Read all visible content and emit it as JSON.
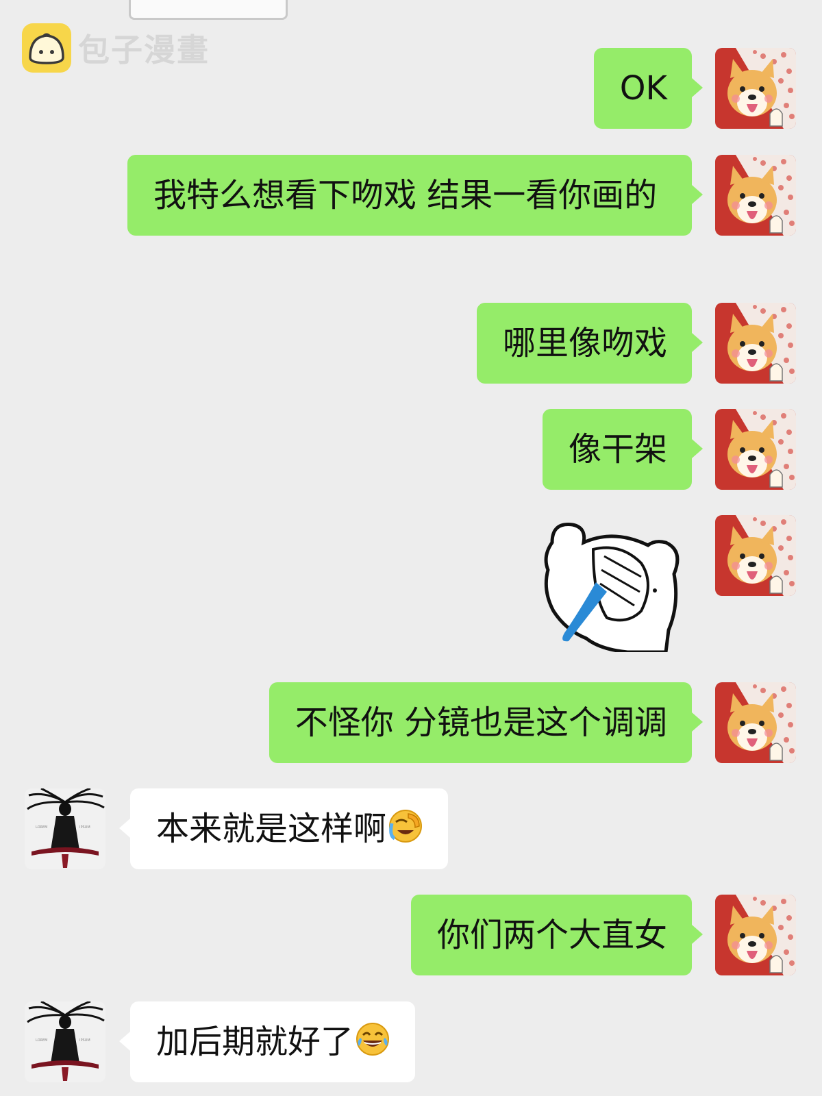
{
  "watermark": {
    "text": "包子漫畫"
  },
  "messages": [
    {
      "side": "right",
      "text": "OK"
    },
    {
      "side": "right",
      "text": "我特么想看下吻戏  结果一看你画的"
    },
    {
      "side": "right",
      "text": "哪里像吻戏"
    },
    {
      "side": "right",
      "text": "像干架"
    },
    {
      "side": "right",
      "type": "sticker",
      "sticker": "crying-bear-facepalm"
    },
    {
      "side": "right",
      "text": "不怪你  分镜也是这个调调"
    },
    {
      "side": "left",
      "text": "本来就是这样啊",
      "emoji": "face-palm-crying-emoji"
    },
    {
      "side": "right",
      "text": "你们两个大直女"
    },
    {
      "side": "left",
      "text": "加后期就好了",
      "emoji": "tears-of-joy-emoji"
    }
  ],
  "colors": {
    "background": "#ededed",
    "sent_bubble": "#95ec69",
    "received_bubble": "#ffffff",
    "watermark_logo": "#f7d64a"
  },
  "avatars": {
    "self": "shiba-dog-avatar",
    "other": "dark-figure-avatar"
  }
}
